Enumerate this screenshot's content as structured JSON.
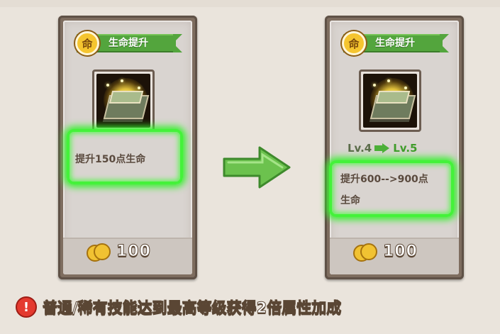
{
  "left_card": {
    "badge": "命",
    "title": "生命提升",
    "description": "提升150点生命",
    "cost": "100"
  },
  "right_card": {
    "badge": "命",
    "title": "生命提升",
    "level_from": "Lv.4",
    "level_to": "Lv.5",
    "description_line1": "提升600-->900点",
    "description_line2": "生命",
    "cost": "100"
  },
  "notice": {
    "icon": "exclamation-icon",
    "text": "普通/稀有技能达到最高等级获得2倍属性加成"
  },
  "colors": {
    "ribbon": "#53a53d",
    "highlight": "#44f23a",
    "arrow": "#4caf38",
    "alert": "#e43a2f"
  }
}
